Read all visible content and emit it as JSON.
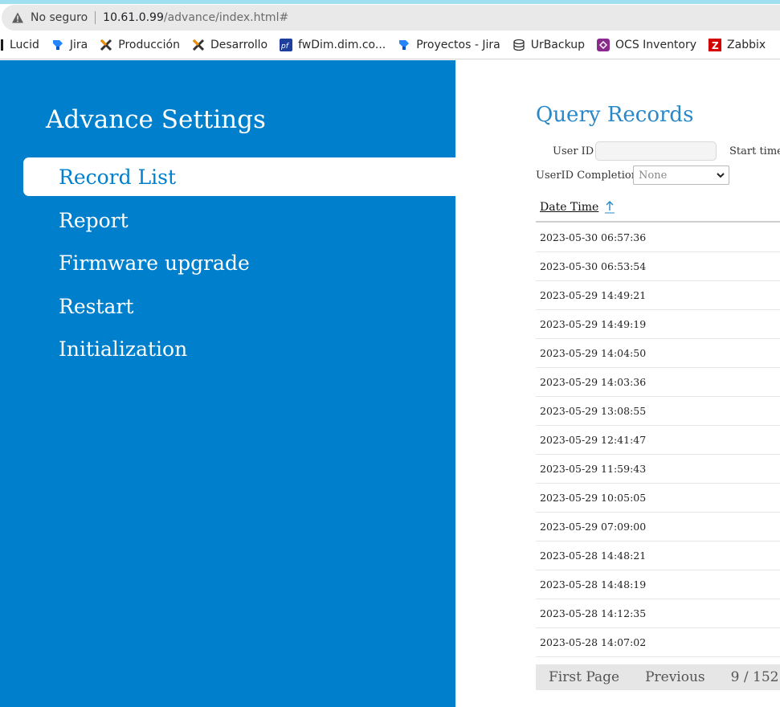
{
  "browser": {
    "security_label": "No seguro",
    "url_host": "10.61.0.99",
    "url_path": "/advance/index.html#"
  },
  "bookmarks": [
    {
      "label": "Lucid",
      "icon": "lucid-icon"
    },
    {
      "label": "Jira",
      "icon": "jira-icon"
    },
    {
      "label": "Producción",
      "icon": "x-logo-icon"
    },
    {
      "label": "Desarrollo",
      "icon": "x-logo-icon"
    },
    {
      "label": "fwDim.dim.co...",
      "icon": "pf-icon"
    },
    {
      "label": "Proyectos - Jira",
      "icon": "jira-icon"
    },
    {
      "label": "UrBackup",
      "icon": "database-icon"
    },
    {
      "label": "OCS Inventory",
      "icon": "ocs-icon"
    },
    {
      "label": "Zabbix",
      "icon": "zabbix-icon"
    }
  ],
  "sidebar": {
    "title": "Advance Settings",
    "items": [
      {
        "label": "Record List",
        "active": true
      },
      {
        "label": "Report",
        "active": false
      },
      {
        "label": "Firmware upgrade",
        "active": false
      },
      {
        "label": "Restart",
        "active": false
      },
      {
        "label": "Initialization",
        "active": false
      }
    ]
  },
  "main": {
    "title": "Query Records",
    "user_id_label": "User ID",
    "start_time_label": "Start time",
    "completion_label": "UserID Completion",
    "completion_value": "None",
    "column_header": "Date Time",
    "rows": [
      "2023-05-30 06:57:36",
      "2023-05-30 06:53:54",
      "2023-05-29 14:49:21",
      "2023-05-29 14:49:19",
      "2023-05-29 14:04:50",
      "2023-05-29 14:03:36",
      "2023-05-29 13:08:55",
      "2023-05-29 12:41:47",
      "2023-05-29 11:59:43",
      "2023-05-29 10:05:05",
      "2023-05-29 07:09:00",
      "2023-05-28 14:48:21",
      "2023-05-28 14:48:19",
      "2023-05-28 14:12:35",
      "2023-05-28 14:07:02"
    ],
    "pager": {
      "first": "First Page",
      "previous": "Previous",
      "page": "9 / 152"
    }
  },
  "colors": {
    "sidebar_bg": "#0080cc",
    "title_blue": "#2a88c8"
  }
}
